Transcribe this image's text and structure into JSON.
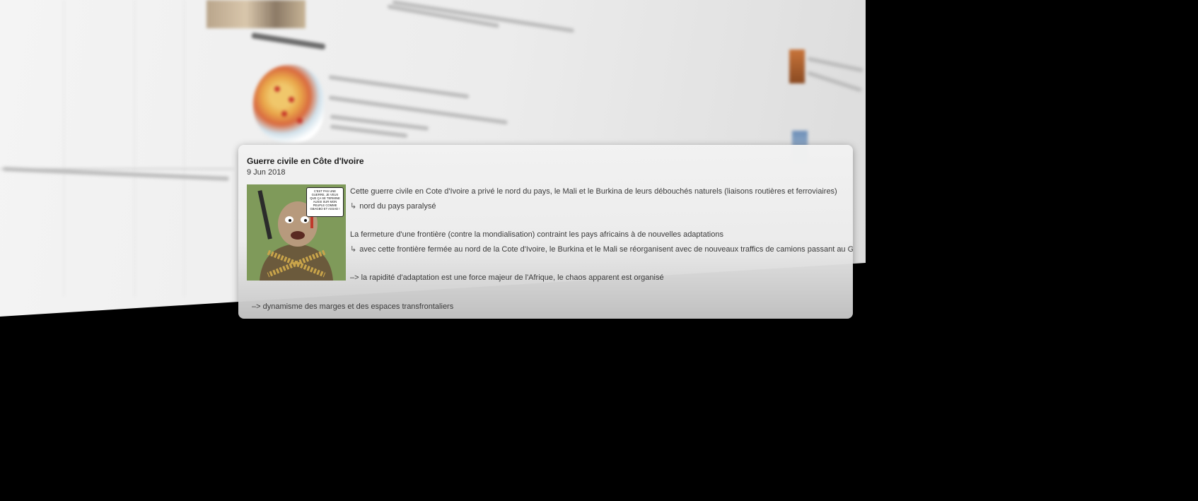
{
  "card": {
    "title": "Guerre civile en Côte d'Ivoire",
    "date": "9 Jun 2018",
    "image_alt_icon": "cartoon-soldier-icon",
    "bubble_text": "C'EST PAS UNE GUERRE, JE VEUX QUE ÇA SE TERMINE AUSSI SUR MON PEUPLE COMME GBAGBO ET ASSAD !",
    "lines": [
      "Cette guerre civile en Cote d'Ivoire a privé le nord du pays, le Mali et le Burkina de leurs débouchés naturels (liaisons routières et ferroviaires)",
      "nord du pays paralysé",
      "La fermeture d'une frontière (contre la mondialisation) contraint les pays africains à de nouvelles adaptations",
      "avec cette frontière fermée au nord de la Cote d'Ivoire, le Burkina et le Mali se réorganisent avec de nouveaux traffics de camions passant au Ghana",
      "–> la rapidité d'adaptation est une force majeur de l'Afrique, le chaos apparent est organisé",
      "–> dynamisme des marges et des espaces transfrontaliers"
    ],
    "sub_arrow": "↳"
  },
  "colors": {
    "cartoon_background": "#7f9a5a",
    "card_background": "#efefef",
    "page_background": "#000000"
  }
}
